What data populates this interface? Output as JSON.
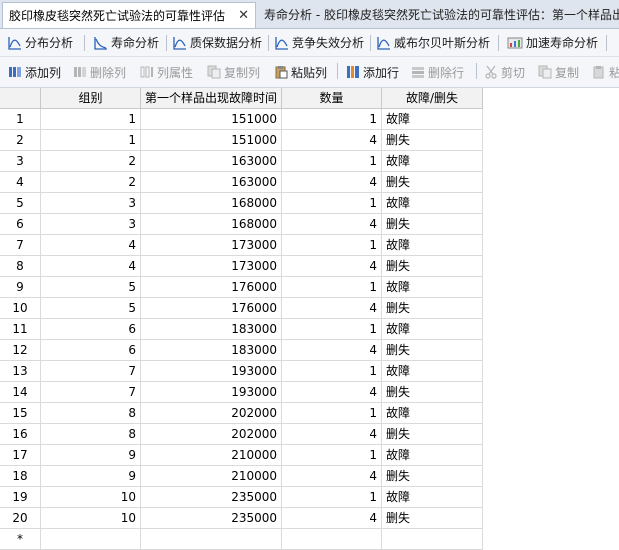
{
  "tabs": [
    {
      "label": "胶印橡皮毯突然死亡试验法的可靠性评估",
      "close": "✕"
    },
    {
      "label": "寿命分析 - 胶印橡皮毯突然死亡试验法的可靠性评估：第一个样品出"
    }
  ],
  "toolbar1": [
    "分布分析",
    "寿命分析",
    "质保数据分析",
    "竞争失效分析",
    "威布尔贝叶斯分析",
    "加速寿命分析"
  ],
  "toolbar2": [
    "添加列",
    "删除列",
    "列属性",
    "复制列",
    "粘贴列",
    "添加行",
    "删除行",
    "剪切",
    "复制",
    "粘"
  ],
  "grid": {
    "columns": [
      "组别",
      "第一个样品出现故障时间",
      "数量",
      "故障/删失"
    ],
    "new_row_marker": "*",
    "rows": [
      {
        "n": "1",
        "group": "1",
        "time": "151000",
        "qty": "1",
        "status": "故障"
      },
      {
        "n": "2",
        "group": "1",
        "time": "151000",
        "qty": "4",
        "status": "删失"
      },
      {
        "n": "3",
        "group": "2",
        "time": "163000",
        "qty": "1",
        "status": "故障"
      },
      {
        "n": "4",
        "group": "2",
        "time": "163000",
        "qty": "4",
        "status": "删失"
      },
      {
        "n": "5",
        "group": "3",
        "time": "168000",
        "qty": "1",
        "status": "故障"
      },
      {
        "n": "6",
        "group": "3",
        "time": "168000",
        "qty": "4",
        "status": "删失"
      },
      {
        "n": "7",
        "group": "4",
        "time": "173000",
        "qty": "1",
        "status": "故障"
      },
      {
        "n": "8",
        "group": "4",
        "time": "173000",
        "qty": "4",
        "status": "删失"
      },
      {
        "n": "9",
        "group": "5",
        "time": "176000",
        "qty": "1",
        "status": "故障"
      },
      {
        "n": "10",
        "group": "5",
        "time": "176000",
        "qty": "4",
        "status": "删失"
      },
      {
        "n": "11",
        "group": "6",
        "time": "183000",
        "qty": "1",
        "status": "故障"
      },
      {
        "n": "12",
        "group": "6",
        "time": "183000",
        "qty": "4",
        "status": "删失"
      },
      {
        "n": "13",
        "group": "7",
        "time": "193000",
        "qty": "1",
        "status": "故障"
      },
      {
        "n": "14",
        "group": "7",
        "time": "193000",
        "qty": "4",
        "status": "删失"
      },
      {
        "n": "15",
        "group": "8",
        "time": "202000",
        "qty": "1",
        "status": "故障"
      },
      {
        "n": "16",
        "group": "8",
        "time": "202000",
        "qty": "4",
        "status": "删失"
      },
      {
        "n": "17",
        "group": "9",
        "time": "210000",
        "qty": "1",
        "status": "故障"
      },
      {
        "n": "18",
        "group": "9",
        "time": "210000",
        "qty": "4",
        "status": "删失"
      },
      {
        "n": "19",
        "group": "10",
        "time": "235000",
        "qty": "1",
        "status": "故障"
      },
      {
        "n": "20",
        "group": "10",
        "time": "235000",
        "qty": "4",
        "status": "删失"
      }
    ]
  }
}
